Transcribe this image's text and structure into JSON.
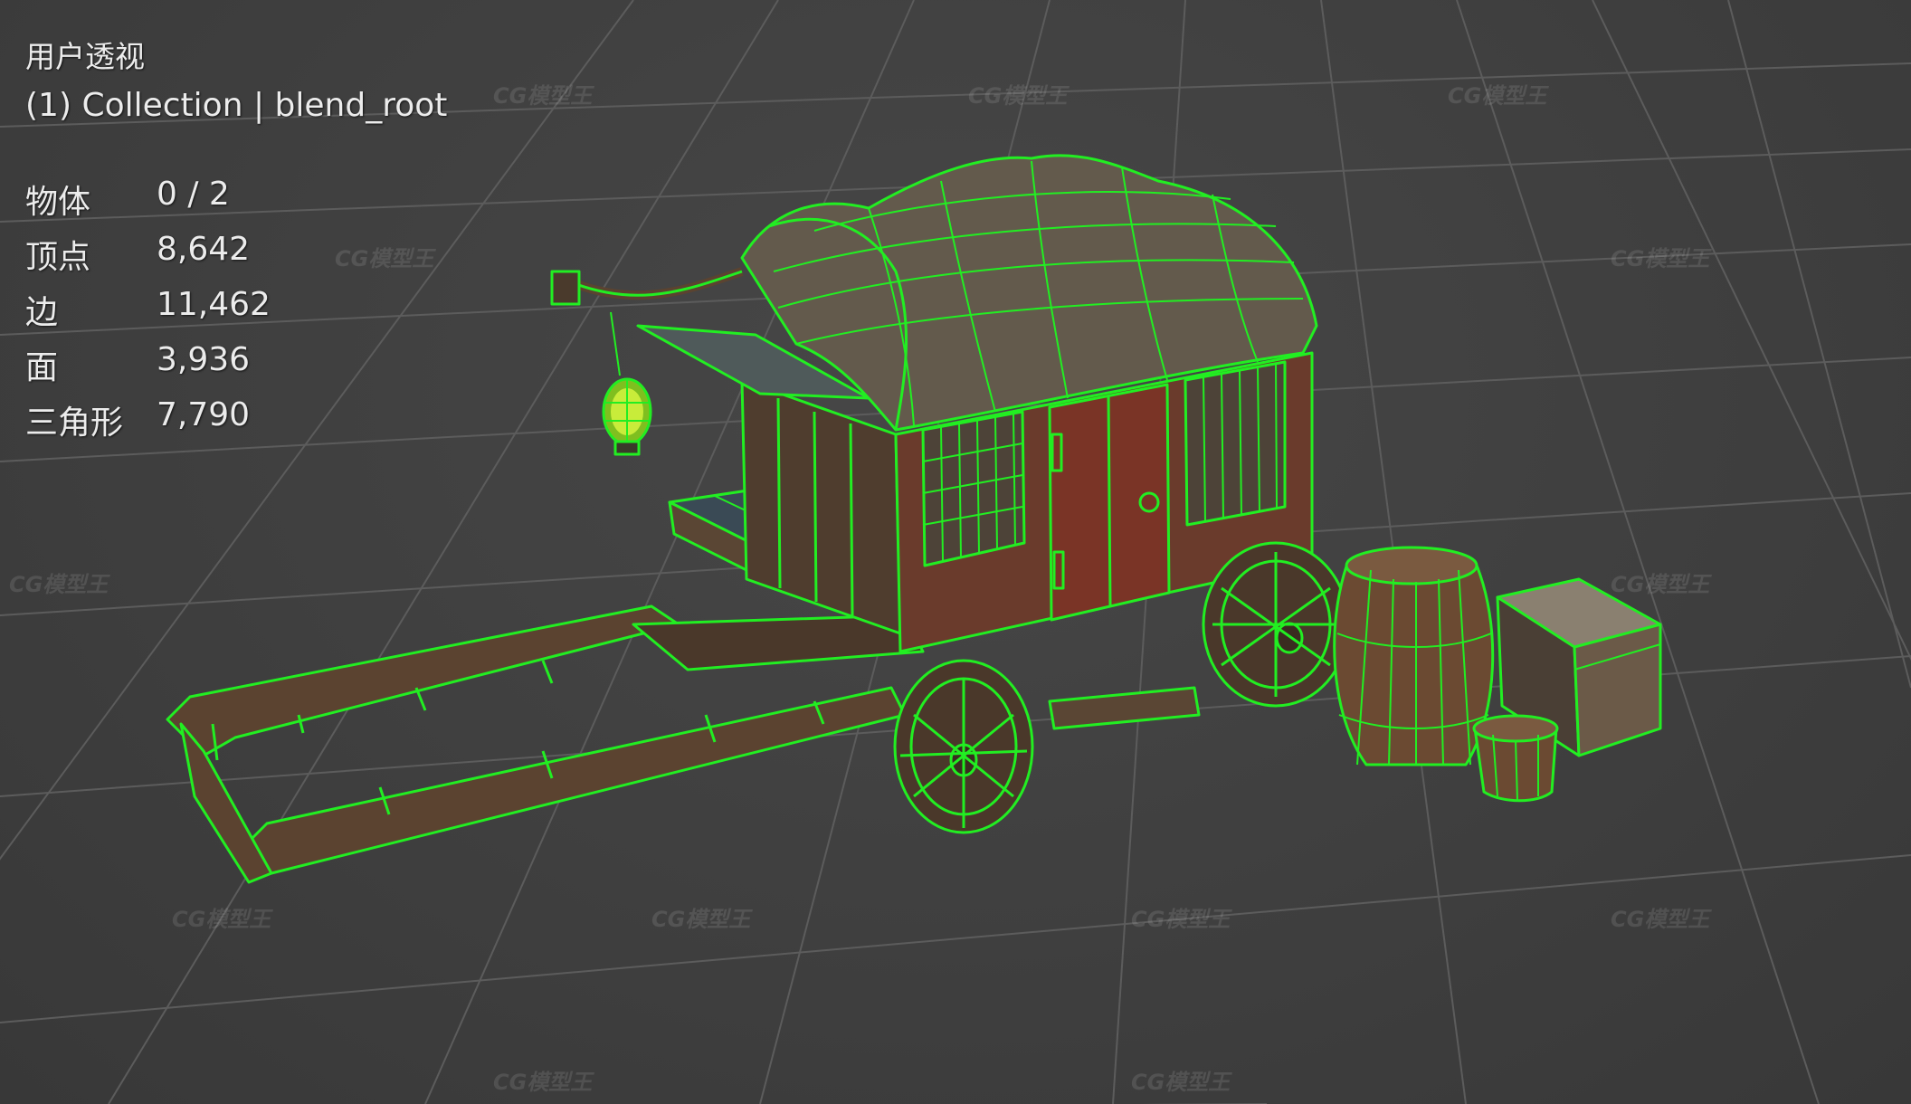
{
  "viewport": {
    "view_name": "用户透视",
    "collection_info": "(1) Collection | blend_root",
    "stats": [
      {
        "label": "物体",
        "value": "0 / 2"
      },
      {
        "label": "顶点",
        "value": "8,642"
      },
      {
        "label": "边",
        "value": "11,462"
      },
      {
        "label": "面",
        "value": "3,936"
      },
      {
        "label": "三角形",
        "value": "7,790"
      }
    ]
  },
  "watermark": {
    "text": "CG模型王"
  },
  "colors": {
    "background": "#3d3d3d",
    "grid_line": "#5a5a5a",
    "wireframe": "#22ee22",
    "wood": "#6b4a32",
    "roof": "#5a5246"
  }
}
